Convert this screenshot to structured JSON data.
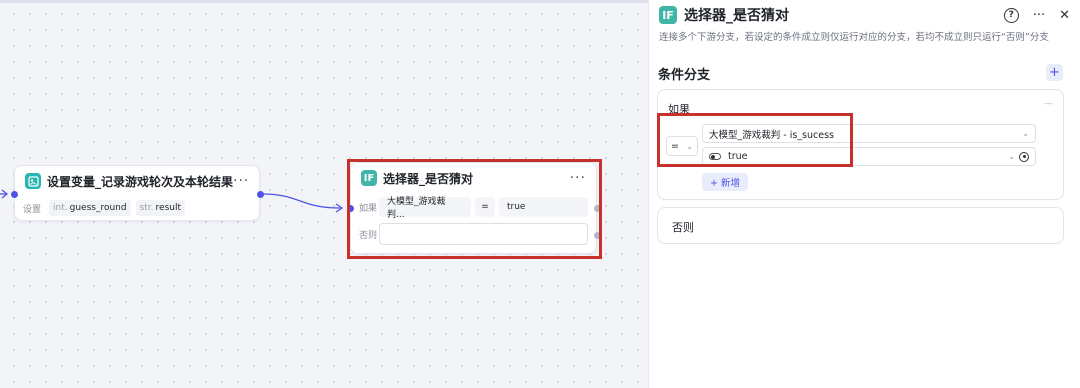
{
  "canvas": {
    "variable_node": {
      "title": "设置变量_记录游戏轮次及本轮结果",
      "icon": "variable-icon",
      "more": "···",
      "set_label": "设置",
      "vars": [
        {
          "type": "int.",
          "name": "guess_round"
        },
        {
          "type": "str.",
          "name": "result"
        }
      ]
    },
    "selector_node": {
      "title": "选择器_是否猜对",
      "icon_text": "IF",
      "more": "···",
      "if_label": "如果",
      "if_left": "大模型_游戏裁判...",
      "operator": "=",
      "if_right": "true",
      "else_label": "否则"
    }
  },
  "panel": {
    "icon_text": "IF",
    "title": "选择器_是否猜对",
    "help": "?",
    "more": "···",
    "close": "✕",
    "description": "连接多个下游分支，若设定的条件成立则仅运行对应的分支，若均不成立则只运行“否则”分支",
    "section_title": "条件分支",
    "add": "+",
    "if_card": {
      "label": "如果",
      "collapse": "—",
      "operator": "=",
      "left_value": "大模型_游戏裁判 - is_sucess",
      "right_value": "true",
      "add_button": "+ 新增"
    },
    "else_card": {
      "label": "否则"
    }
  },
  "colors": {
    "accent": "#4d53e8",
    "if_icon": "#3fb6a8",
    "variable_icon": "#27b5b0",
    "highlight": "#c8302b"
  }
}
